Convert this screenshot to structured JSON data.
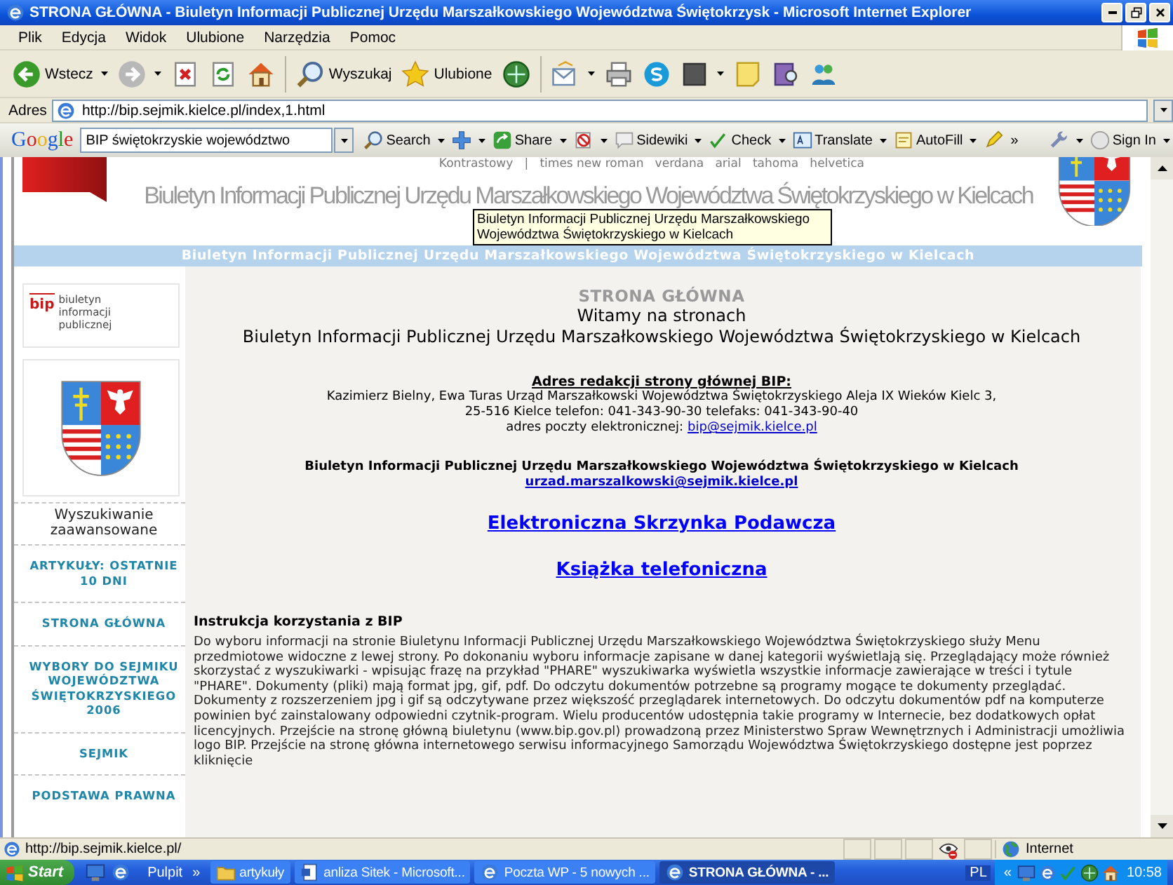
{
  "window": {
    "title": "STRONA GŁÓWNA - Biuletyn Informacji Publicznej Urzędu Marszałkowskiego Województwa Świętokrzysk - Microsoft Internet Explorer"
  },
  "menu": [
    "Plik",
    "Edycja",
    "Widok",
    "Ulubione",
    "Narzędzia",
    "Pomoc"
  ],
  "toolbar": [
    {
      "kind": "back",
      "label": "Wstecz",
      "dropdown": true
    },
    {
      "kind": "forward",
      "dropdown": true
    },
    {
      "kind": "stop",
      "dropdown": false
    },
    {
      "kind": "refresh",
      "dropdown": false
    },
    {
      "kind": "home",
      "dropdown": false
    },
    {
      "kind": "search",
      "label": "Wyszukaj",
      "dropdown": false
    },
    {
      "kind": "favorites",
      "label": "Ulubione",
      "dropdown": false
    },
    {
      "kind": "media",
      "dropdown": false
    },
    {
      "kind": "mail",
      "dropdown": true
    },
    {
      "kind": "print",
      "dropdown": false
    },
    {
      "kind": "skype",
      "dropdown": false
    },
    {
      "kind": "square",
      "dropdown": true
    },
    {
      "kind": "note",
      "dropdown": false
    },
    {
      "kind": "research",
      "dropdown": false
    },
    {
      "kind": "messenger",
      "dropdown": false
    }
  ],
  "address": {
    "label": "Adres",
    "value": "http://bip.sejmik.kielce.pl/index,1.html"
  },
  "google_toolbar": {
    "logo": "Google",
    "search_value": "BIP świętokrzyskie województwo",
    "items": [
      {
        "kind": "search",
        "label": "Search",
        "dropdown": true
      },
      {
        "kind": "plus",
        "dropdown": true
      },
      {
        "kind": "share",
        "label": "Share",
        "dropdown": true
      },
      {
        "kind": "block",
        "dropdown": true
      },
      {
        "kind": "sidewiki",
        "label": "Sidewiki",
        "dropdown": true
      },
      {
        "kind": "check",
        "label": "Check",
        "dropdown": true
      },
      {
        "kind": "translate",
        "label": "Translate",
        "dropdown": true
      },
      {
        "kind": "autofill",
        "label": "AutoFill",
        "dropdown": true
      },
      {
        "kind": "pen",
        "dropdown": false
      },
      {
        "kind": "more",
        "label": "»",
        "dropdown": false
      }
    ],
    "right_items": [
      {
        "kind": "wrench",
        "dropdown": true
      },
      {
        "kind": "signin",
        "label": "Sign In",
        "dropdown": true
      }
    ]
  },
  "page": {
    "font_links": "Kontrastowy   |   times new roman   verdana   arial   tahoma   helvetica",
    "banner_title": "Biuletyn Informacji Publicznej Urzędu Marszałkowskiego Województwa Świętokrzyskiego w Kielcach",
    "tooltip": "Biuletyn Informacji Publicznej Urzędu Marszałkowskiego Województwa Świętokrzyskiego w Kielcach",
    "strip_title": "Biuletyn Informacji Publicznej Urzędu Marszałkowskiego Województwa Świętokrzyskiego w Kielcach",
    "sidebar": {
      "logo_mark": "bip",
      "logo_caption": "biuletyn informacji publicznej",
      "search_link": "Wyszukiwanie zaawansowane",
      "items": [
        "ARTYKUŁY: OSTATNIE 10 DNI",
        "STRONA GŁÓWNA",
        "WYBORY DO SEJMIKU WOJEWÓDZTWA ŚWIĘTOKRZYSKIEGO 2006",
        "SEJMIK",
        "PODSTAWA PRAWNA"
      ]
    },
    "content": {
      "heading": "STRONA GŁÓWNA",
      "welcome": "Witamy na stronach",
      "site_name": "Biuletyn Informacji Publicznej Urzędu Marszałkowskiego Województwa Świętokrzyskiego w Kielcach",
      "address_heading": "Adres redakcji strony głównej BIP:",
      "address_lines": [
        "Kazimierz Bielny, Ewa Turas Urząd Marszałkowski Województwa Świętokrzyskiego Aleja IX Wieków Kielc 3,",
        "25-516 Kielce telefon: 041-343-90-30 telefaks: 041-343-90-40"
      ],
      "email_label": "adres poczty elektronicznej:",
      "email": "bip@sejmik.kielce.pl",
      "office_name": "Biuletyn Informacji Publicznej Urzędu Marszałkowskiego Województwa Świętokrzyskiego w Kielcach",
      "office_email": "urzad.marszalkowski@sejmik.kielce.pl",
      "big_links": [
        "Elektroniczna Skrzynka Podawcza",
        "Książka telefoniczna"
      ],
      "instructions_heading": "Instrukcja korzystania z BIP",
      "instructions": "Do wyboru informacji na stronie Biuletynu Informacji Publicznej Urzędu Marszałkowskiego Województwa Świętokrzyskiego służy Menu przedmiotowe widoczne z lewej strony. Po dokonaniu wyboru informacje zapisane w danej kategorii wyświetlają się. Przeglądający może również skorzystać z wyszukiwarki - wpisując frazę na przykład \"PHARE\" wyszukiwarka wyświetla wszystkie informacje zawierające w treści i tytule \"PHARE\". Dokumenty (pliki) mają format jpg, gif, pdf. Do odczytu dokumentów potrzebne są programy mogące te dokumenty przeglądać. Dokumenty z rozszerzeniem jpg i gif są odczytywane przez większość przeglądarek internetowych. Do odczytu dokumentów pdf na komputerze powinien być zainstalowany odpowiedni czytnik-program. Wielu producentów udostępnia takie programy w Internecie, bez dodatkowych opłat licencyjnych. Przejście na stronę główną biuletynu (www.bip.gov.pl) prowadzoną przez Ministerstwo Spraw Wewnętrznych i Administracji umożliwia logo BIP. Przejście na stronę główna internetowego serwisu informacyjnego Samorządu Województwa Świętokrzyskiego dostępne jest poprzez kliknięcie"
    }
  },
  "status_bar": {
    "url": "http://bip.sejmik.kielce.pl/",
    "zone": "Internet"
  },
  "taskbar": {
    "start": "Start",
    "toolbar_label": "Pulpit",
    "chevron": "»",
    "tasks": [
      {
        "kind": "folder",
        "label": "artykuły",
        "selected": false
      },
      {
        "kind": "word",
        "label": "anliza Sitek - Microsoft...",
        "selected": false
      },
      {
        "kind": "ie",
        "label": "Poczta WP - 5 nowych ...",
        "selected": false
      },
      {
        "kind": "ie",
        "label": "STRONA GŁÓWNA - ...",
        "selected": true
      }
    ],
    "language": "PL",
    "tray_chevron": "«",
    "clock": "10:58"
  }
}
